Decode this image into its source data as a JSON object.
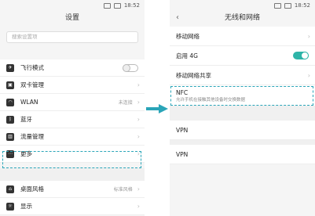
{
  "left": {
    "time": "18:52",
    "title": "设置",
    "search_placeholder": "搜索设置项",
    "items": [
      {
        "label": "飞行模式",
        "value": "",
        "icon": "airplane-icon"
      },
      {
        "label": "双卡管理",
        "value": "",
        "icon": "sim-icon"
      },
      {
        "label": "WLAN",
        "value": "未连接",
        "icon": "wifi-icon"
      },
      {
        "label": "蓝牙",
        "value": "",
        "icon": "bluetooth-icon"
      },
      {
        "label": "流量管理",
        "value": "",
        "icon": "data-usage-icon"
      },
      {
        "label": "更多",
        "value": "",
        "icon": "more-icon"
      },
      {
        "label": "桌面风格",
        "value": "标准风格",
        "icon": "home-style-icon"
      },
      {
        "label": "显示",
        "value": "",
        "icon": "display-icon"
      }
    ]
  },
  "right": {
    "time": "18:52",
    "title": "无线和网络",
    "items": [
      {
        "label": "移动网络",
        "sub": ""
      },
      {
        "label": "启用 4G",
        "sub": ""
      },
      {
        "label": "移动网络共享",
        "sub": ""
      },
      {
        "label": "NFC",
        "sub": "允许手机在接触其他设备时交换数据"
      },
      {
        "label": "VPN",
        "sub": ""
      },
      {
        "label": "VPN",
        "sub": ""
      }
    ]
  },
  "colors": {
    "accent": "#2eb4a8",
    "highlight": "#2aa5b8"
  }
}
